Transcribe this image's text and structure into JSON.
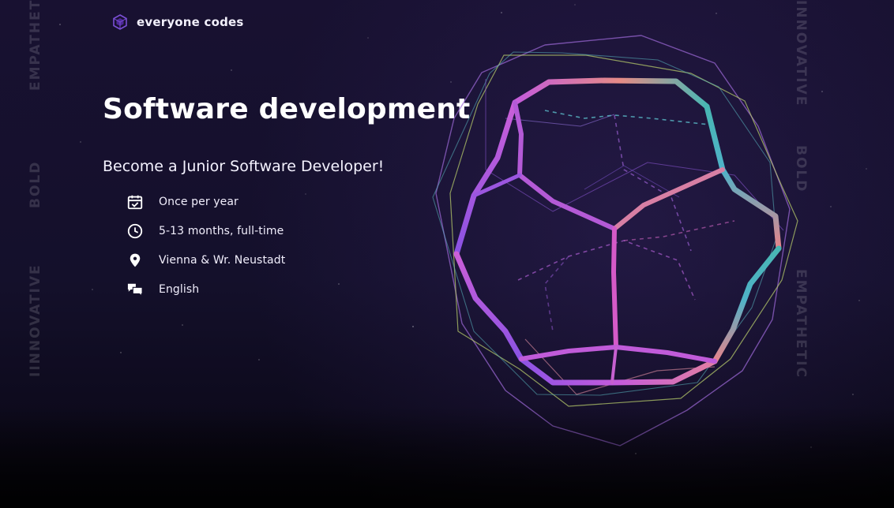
{
  "brand": {
    "name": "everyone codes",
    "icon": "cube-logo-icon",
    "accent": "#7b4fd6"
  },
  "side_words": {
    "left": [
      "EMPATHETIC",
      "BOLD",
      "IINNOVATIVE"
    ],
    "right": [
      "INNOVATIVE",
      "BOLD",
      "EMPATHETIC"
    ]
  },
  "hero": {
    "title": "Software development",
    "subtitle": "Become a Junior Software Developer!"
  },
  "facts": [
    {
      "icon": "calendar-check-icon",
      "label": "Once per year"
    },
    {
      "icon": "clock-icon",
      "label": "5-13 months, full-time"
    },
    {
      "icon": "location-pin-icon",
      "label": "Vienna & Wr. Neustadt"
    },
    {
      "icon": "chat-bubbles-icon",
      "label": "English"
    }
  ],
  "artwork": {
    "icon": "wireframe-dodecahedron-icon",
    "colors": {
      "magenta": "#c85ed8",
      "violet": "#8a52e3",
      "teal": "#45b7b6",
      "peach": "#e7908e",
      "lime": "#b9d266"
    }
  },
  "colors": {
    "background": "#14102b",
    "text": "#ffffff",
    "muted_side_text": "#4a4560"
  }
}
